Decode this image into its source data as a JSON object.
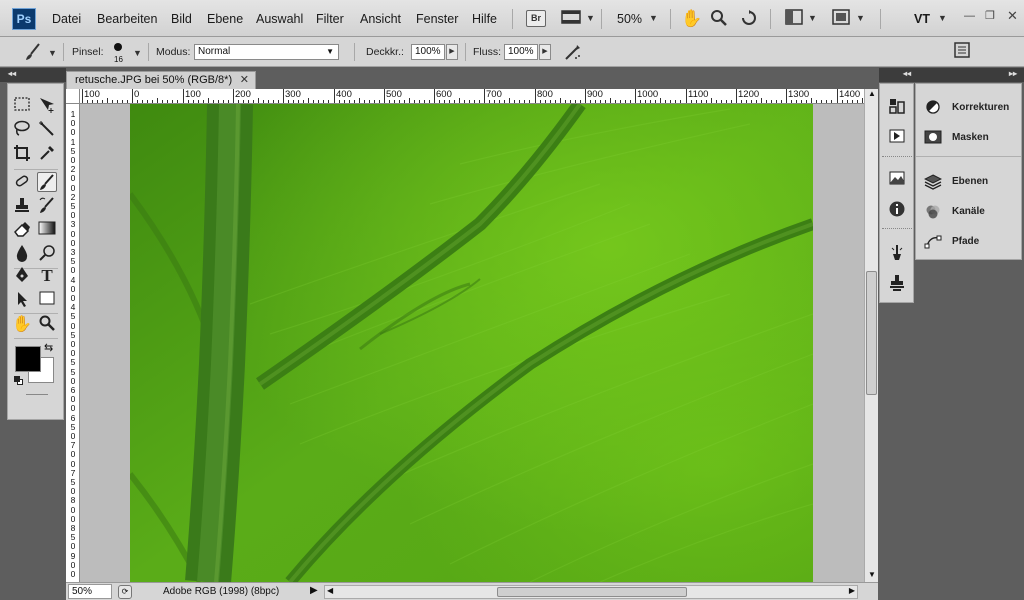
{
  "app": {
    "logo": "Ps",
    "menus": [
      "Datei",
      "Bearbeiten",
      "Bild",
      "Ebene",
      "Auswahl",
      "Filter",
      "Ansicht",
      "Fenster",
      "Hilfe"
    ],
    "bridge_label": "Br",
    "zoom_menu_value": "50%",
    "workspace": "VT"
  },
  "options": {
    "brush_label": "Pinsel:",
    "brush_size": "16",
    "mode_label": "Modus:",
    "mode_value": "Normal",
    "opacity_label": "Deckkr.:",
    "opacity_value": "100%",
    "flow_label": "Fluss:",
    "flow_value": "100%"
  },
  "document": {
    "tab_title": "retusche.JPG bei 50% (RGB/8*)",
    "ruler_top_labels": [
      "100",
      "0",
      "100",
      "200",
      "300",
      "400",
      "500",
      "600",
      "700",
      "800",
      "900",
      "1000",
      "1100",
      "1200",
      "1300",
      "1400"
    ],
    "ruler_left_labels": [
      "1",
      "0",
      "0",
      "1",
      "5",
      "0",
      "2",
      "0",
      "0",
      "2",
      "5",
      "0",
      "3",
      "0",
      "0",
      "3",
      "5",
      "0",
      "4",
      "0",
      "0",
      "4",
      "5",
      "0",
      "5",
      "0",
      "0",
      "5",
      "5",
      "0",
      "6",
      "0",
      "0",
      "6",
      "5",
      "0",
      "7",
      "0",
      "0",
      "7",
      "5",
      "0",
      "8",
      "0",
      "0",
      "8",
      "5",
      "0",
      "9",
      "0",
      "0"
    ]
  },
  "status": {
    "zoom": "50%",
    "profile": "Adobe RGB (1998) (8bpc)"
  },
  "panels": [
    {
      "label": "Korrekturen",
      "icon": "adjustments-icon"
    },
    {
      "label": "Masken",
      "icon": "masks-icon"
    },
    {
      "label": "Ebenen",
      "icon": "layers-icon"
    },
    {
      "label": "Kanäle",
      "icon": "channels-icon"
    },
    {
      "label": "Pfade",
      "icon": "paths-icon"
    }
  ],
  "colors": {
    "foreground": "#000000",
    "background": "#ffffff",
    "leaf_base": "#4f9b16"
  }
}
